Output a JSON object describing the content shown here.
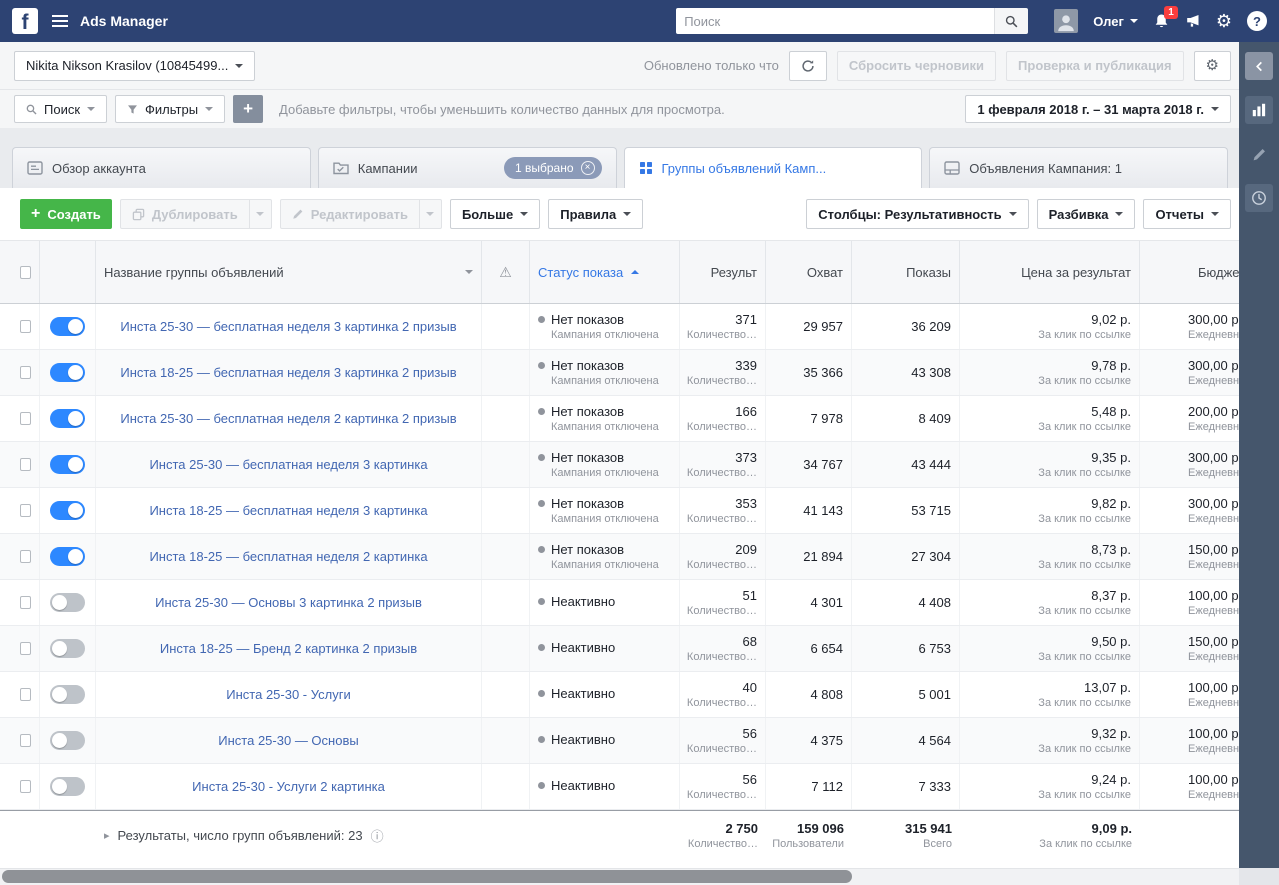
{
  "colors": {
    "topbar_bg": "#2d4373",
    "accent_blue": "#3578e5",
    "toggle_on_blue": "#2d88ff",
    "create_green": "#45b649",
    "notification_red": "#fa3e3e",
    "link_blue": "#4267b2"
  },
  "topbar": {
    "title": "Ads Manager",
    "search_placeholder": "Поиск",
    "user_name": "Олег",
    "notification_badge": "1"
  },
  "account_bar": {
    "account_selector": "Nikita Nikson Krasilov (10845499...",
    "updated_text": "Обновлено только что",
    "discard_drafts_label": "Сбросить черновики",
    "review_publish_label": "Проверка и публикация"
  },
  "filter_bar": {
    "search_button": "Поиск",
    "filters_button": "Фильтры",
    "hint": "Добавьте фильтры, чтобы уменьшить количество данных для просмотра.",
    "date_range": "1 февраля 2018 г. – 31 марта 2018 г."
  },
  "tabs": {
    "account_overview": "Обзор аккаунта",
    "campaigns": "Кампании",
    "campaigns_selected_badge": "1 выбрано",
    "adsets": "Группы объявлений Камп...",
    "ads": "Объявления Кампания: 1"
  },
  "toolbar": {
    "create": "Создать",
    "duplicate": "Дублировать",
    "edit": "Редактировать",
    "more": "Больше",
    "rules": "Правила",
    "columns": "Столбцы: Результативность",
    "breakdown": "Разбивка",
    "reports": "Отчеты"
  },
  "table": {
    "headers": {
      "name": "Название группы объявлений",
      "delivery_status": "Статус показа",
      "results": "Результ",
      "reach": "Охват",
      "impressions": "Показы",
      "cost_per_result": "Цена за результат",
      "budget": "Бюджет"
    },
    "rows": [
      {
        "active": true,
        "name": "Инста 25-30 — бесплатная неделя 3 картинка 2 призыв",
        "status": "Нет показов",
        "status_sub": "Кампания отключена",
        "results": "371",
        "results_sub": "Количество…",
        "reach": "29 957",
        "impressions": "36 209",
        "cost": "9,02 р.",
        "cost_sub": "За клик по ссылке",
        "budget": "300,00 р",
        "budget_sub": "Ежедневн"
      },
      {
        "active": true,
        "name": "Инста 18-25 — бесплатная неделя 3 картинка 2 призыв",
        "status": "Нет показов",
        "status_sub": "Кампания отключена",
        "results": "339",
        "results_sub": "Количество…",
        "reach": "35 366",
        "impressions": "43 308",
        "cost": "9,78 р.",
        "cost_sub": "За клик по ссылке",
        "budget": "300,00 р",
        "budget_sub": "Ежедневн"
      },
      {
        "active": true,
        "name": "Инста 25-30 — бесплатная неделя 2 картинка 2 призыв",
        "status": "Нет показов",
        "status_sub": "Кампания отключена",
        "results": "166",
        "results_sub": "Количество…",
        "reach": "7 978",
        "impressions": "8 409",
        "cost": "5,48 р.",
        "cost_sub": "За клик по ссылке",
        "budget": "200,00 р",
        "budget_sub": "Ежедневн"
      },
      {
        "active": true,
        "name": "Инста 25-30 — бесплатная неделя 3 картинка",
        "status": "Нет показов",
        "status_sub": "Кампания отключена",
        "results": "373",
        "results_sub": "Количество…",
        "reach": "34 767",
        "impressions": "43 444",
        "cost": "9,35 р.",
        "cost_sub": "За клик по ссылке",
        "budget": "300,00 р",
        "budget_sub": "Ежедневн"
      },
      {
        "active": true,
        "name": "Инста 18-25 — бесплатная неделя 3 картинка",
        "status": "Нет показов",
        "status_sub": "Кампания отключена",
        "results": "353",
        "results_sub": "Количество…",
        "reach": "41 143",
        "impressions": "53 715",
        "cost": "9,82 р.",
        "cost_sub": "За клик по ссылке",
        "budget": "300,00 р",
        "budget_sub": "Ежедневн"
      },
      {
        "active": true,
        "name": "Инста 18-25 — бесплатная неделя 2 картинка",
        "status": "Нет показов",
        "status_sub": "Кампания отключена",
        "results": "209",
        "results_sub": "Количество…",
        "reach": "21 894",
        "impressions": "27 304",
        "cost": "8,73 р.",
        "cost_sub": "За клик по ссылке",
        "budget": "150,00 р",
        "budget_sub": "Ежедневн"
      },
      {
        "active": false,
        "name": "Инста 25-30 — Основы 3 картинка 2 призыв",
        "status": "Неактивно",
        "status_sub": "",
        "results": "51",
        "results_sub": "Количество…",
        "reach": "4 301",
        "impressions": "4 408",
        "cost": "8,37 р.",
        "cost_sub": "За клик по ссылке",
        "budget": "100,00 р",
        "budget_sub": "Ежедневн"
      },
      {
        "active": false,
        "name": "Инста 18-25 — Бренд 2 картинка 2 призыв",
        "status": "Неактивно",
        "status_sub": "",
        "results": "68",
        "results_sub": "Количество…",
        "reach": "6 654",
        "impressions": "6 753",
        "cost": "9,50 р.",
        "cost_sub": "За клик по ссылке",
        "budget": "150,00 р",
        "budget_sub": "Ежедневн"
      },
      {
        "active": false,
        "name": "Инста 25-30 - Услуги",
        "status": "Неактивно",
        "status_sub": "",
        "results": "40",
        "results_sub": "Количество…",
        "reach": "4 808",
        "impressions": "5 001",
        "cost": "13,07 р.",
        "cost_sub": "За клик по ссылке",
        "budget": "100,00 р",
        "budget_sub": "Ежедневн"
      },
      {
        "active": false,
        "name": "Инста 25-30 — Основы",
        "status": "Неактивно",
        "status_sub": "",
        "results": "56",
        "results_sub": "Количество…",
        "reach": "4 375",
        "impressions": "4 564",
        "cost": "9,32 р.",
        "cost_sub": "За клик по ссылке",
        "budget": "100,00 р",
        "budget_sub": "Ежедневн"
      },
      {
        "active": false,
        "name": "Инста 25-30 - Услуги 2 картинка",
        "status": "Неактивно",
        "status_sub": "",
        "results": "56",
        "results_sub": "Количество…",
        "reach": "7 112",
        "impressions": "7 333",
        "cost": "9,24 р.",
        "cost_sub": "За клик по ссылке",
        "budget": "100,00 р",
        "budget_sub": "Ежедневн"
      }
    ],
    "footer": {
      "expander_label": "Результаты, число групп объявлений: 23",
      "results": "2 750",
      "results_sub": "Количество…",
      "reach": "159 096",
      "reach_sub": "Пользователи",
      "impressions": "315 941",
      "impressions_sub": "Всего",
      "cost": "9,09 р.",
      "cost_sub": "За клик по ссылке"
    }
  }
}
